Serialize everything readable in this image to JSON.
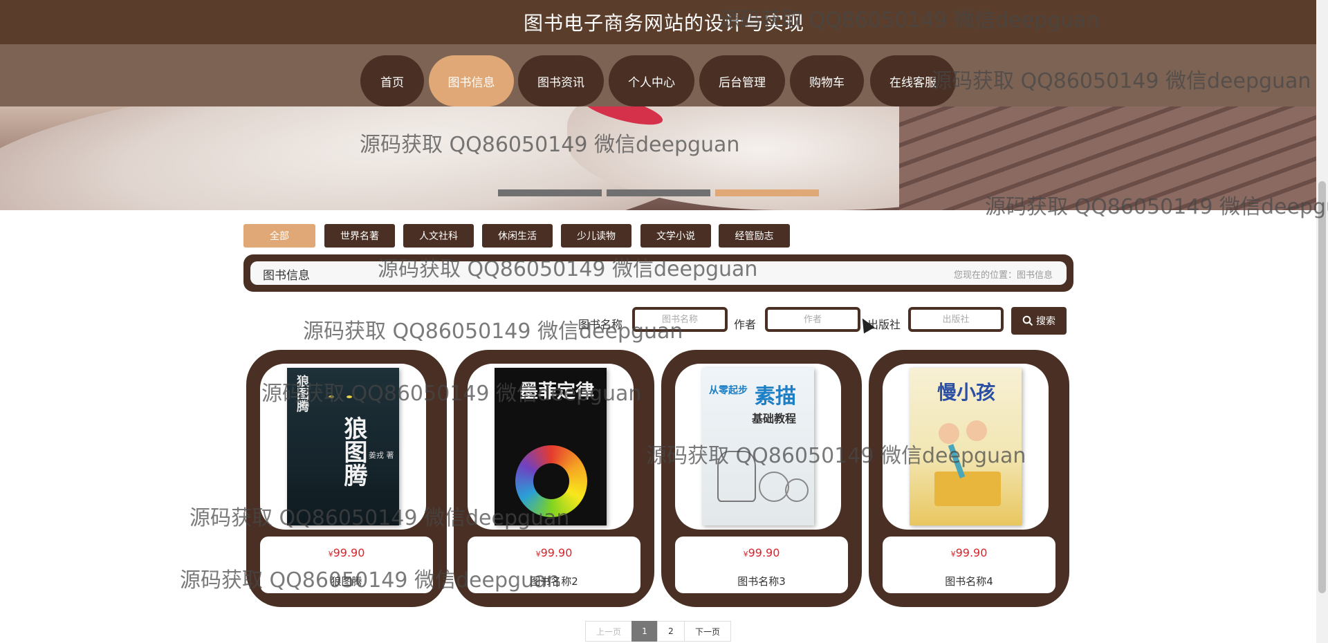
{
  "header": {
    "site_title": "图书电子商务网站的设计与实现"
  },
  "nav": [
    {
      "label": "首页",
      "active": false
    },
    {
      "label": "图书信息",
      "active": true
    },
    {
      "label": "图书资讯",
      "active": false
    },
    {
      "label": "个人中心",
      "active": false
    },
    {
      "label": "后台管理",
      "active": false
    },
    {
      "label": "购物车",
      "active": false
    },
    {
      "label": "在线客服",
      "active": false
    }
  ],
  "carousel": {
    "slide_count": 3,
    "active_index": 2
  },
  "categories": [
    {
      "label": "全部",
      "active": true
    },
    {
      "label": "世界名著",
      "active": false
    },
    {
      "label": "人文社科",
      "active": false
    },
    {
      "label": "休闲生活",
      "active": false
    },
    {
      "label": "少儿读物",
      "active": false
    },
    {
      "label": "文学小说",
      "active": false
    },
    {
      "label": "经管励志",
      "active": false
    }
  ],
  "breadcrumb": {
    "title": "图书信息",
    "location": "您现在的位置：图书信息"
  },
  "search": {
    "book_name_label": "图书名称",
    "book_name_placeholder": "图书名称",
    "author_label": "作者",
    "author_placeholder": "作者",
    "publisher_label": "出版社",
    "publisher_placeholder": "出版社",
    "button_label": "搜索"
  },
  "books": [
    {
      "name": "狼图腾",
      "currency": "¥",
      "price": "99.90",
      "cover_title": "狼图腾",
      "cover_author": "姜戎 著"
    },
    {
      "name": "图书名称2",
      "currency": "¥",
      "price": "99.90",
      "cover_title": "墨菲定律"
    },
    {
      "name": "图书名称3",
      "currency": "¥",
      "price": "99.90",
      "cover_title": "素描",
      "cover_subtitle": "基础教程",
      "cover_small": "从零起步"
    },
    {
      "name": "图书名称4",
      "currency": "¥",
      "price": "99.90",
      "cover_title": "慢小孩"
    }
  ],
  "pagination": {
    "prev": "上一页",
    "pages": [
      "1",
      "2"
    ],
    "current": "1",
    "next": "下一页"
  },
  "watermark": "源码获取 QQ86050149 微信deepguan",
  "colors": {
    "primary": "#4a3024",
    "accent": "#e0a877",
    "price": "#d9242b",
    "header": "#5a3d2a"
  }
}
